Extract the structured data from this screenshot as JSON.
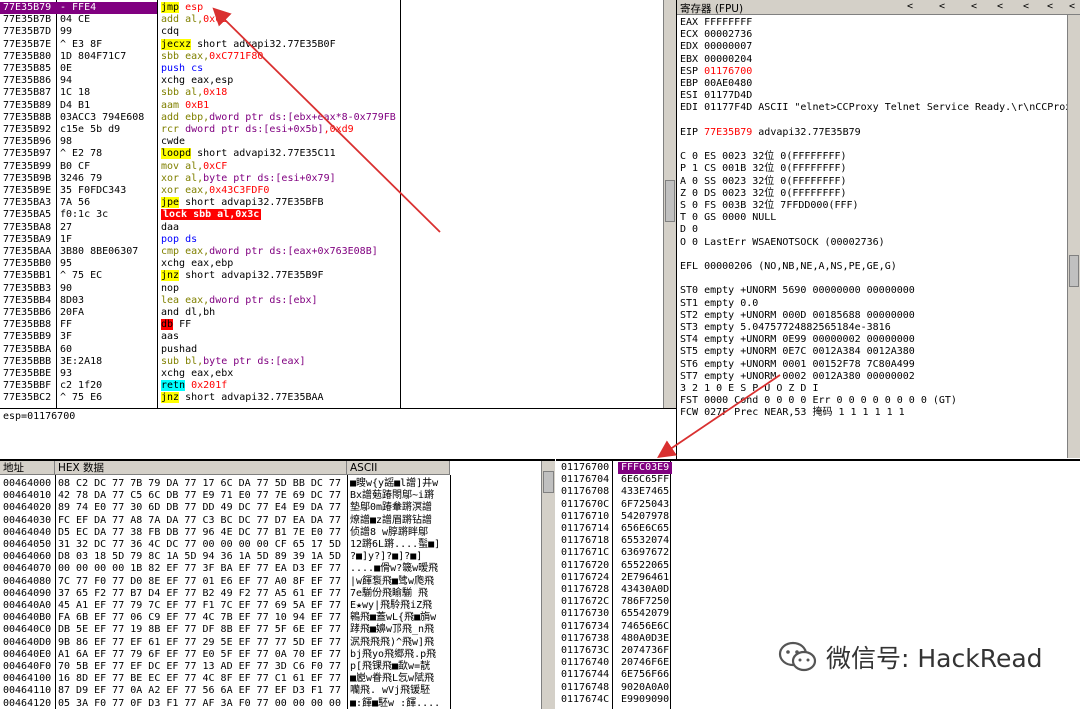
{
  "cpu": {
    "rows": [
      {
        "addr": "77E35B79",
        "hex": "- FFE4",
        "sel": true,
        "parts": [
          [
            "jmp",
            "hl-y"
          ],
          [
            " esp",
            "k-red"
          ]
        ]
      },
      {
        "addr": "77E35B7B",
        "hex": "  04 CE",
        "parts": [
          [
            "add al,",
            "k-olive"
          ],
          [
            "0xCE",
            "k-red"
          ]
        ]
      },
      {
        "addr": "77E35B7D",
        "hex": "  99",
        "parts": [
          [
            "cdq",
            ""
          ]
        ]
      },
      {
        "addr": "77E35B7E",
        "hex": "^ E3 8F",
        "parts": [
          [
            "jecxz",
            "hl-y"
          ],
          [
            " short advapi32.77E35B0F",
            ""
          ]
        ]
      },
      {
        "addr": "77E35B80",
        "hex": "  1D 804F71C7",
        "parts": [
          [
            "sbb eax,",
            "k-olive"
          ],
          [
            "0xC771F80",
            "k-red"
          ]
        ]
      },
      {
        "addr": "77E35B85",
        "hex": "  0E",
        "parts": [
          [
            "push cs",
            "k-blue"
          ]
        ]
      },
      {
        "addr": "77E35B86",
        "hex": "  94",
        "parts": [
          [
            "xchg eax,esp",
            ""
          ]
        ]
      },
      {
        "addr": "77E35B87",
        "hex": "  1C 18",
        "parts": [
          [
            "sbb al,",
            "k-olive"
          ],
          [
            "0x18",
            "k-red"
          ]
        ]
      },
      {
        "addr": "77E35B89",
        "hex": "  D4 B1",
        "parts": [
          [
            "aam ",
            "k-olive"
          ],
          [
            "0xB1",
            "k-red"
          ]
        ]
      },
      {
        "addr": "77E35B8B",
        "hex": "  03ACC3 794E608",
        "parts": [
          [
            "add ebp,",
            "k-olive"
          ],
          [
            "dword ptr ds:[ebx+eax*8-0x779FB",
            "k-dpurple"
          ]
        ]
      },
      {
        "addr": "77E35B92",
        "hex": "  c15e 5b d9",
        "parts": [
          [
            "rcr ",
            "k-olive"
          ],
          [
            "dword ptr ds:[esi+0x5b]",
            "k-dpurple"
          ],
          [
            ",0xd9",
            "k-red"
          ]
        ]
      },
      {
        "addr": "77E35B96",
        "hex": "  98",
        "parts": [
          [
            "cwde",
            ""
          ]
        ]
      },
      {
        "addr": "77E35B97",
        "hex": "^ E2 78",
        "parts": [
          [
            "loopd",
            "hl-y"
          ],
          [
            " short advapi32.77E35C11",
            ""
          ]
        ]
      },
      {
        "addr": "77E35B99",
        "hex": "  B0 CF",
        "parts": [
          [
            "mov al,",
            "k-olive"
          ],
          [
            "0xCF",
            "k-red"
          ]
        ]
      },
      {
        "addr": "77E35B9B",
        "hex": "  3246 79",
        "parts": [
          [
            "xor al,",
            "k-olive"
          ],
          [
            "byte ptr ds:[esi+0x79]",
            "k-dpurple"
          ]
        ]
      },
      {
        "addr": "77E35B9E",
        "hex": "  35 F0FDC343",
        "parts": [
          [
            "xor eax,",
            "k-olive"
          ],
          [
            "0x43C3FDF0",
            "k-red"
          ]
        ]
      },
      {
        "addr": "77E35BA3",
        "hex": "  7A 56",
        "parts": [
          [
            "jpe",
            "hl-y"
          ],
          [
            " short advapi32.77E35BFB",
            ""
          ]
        ]
      },
      {
        "addr": "77E35BA5",
        "hex": "  f0:1c 3c",
        "parts": [
          [
            "lock sbb al,0x3c",
            "lockline"
          ]
        ]
      },
      {
        "addr": "77E35BA8",
        "hex": "  27",
        "parts": [
          [
            "daa",
            ""
          ]
        ]
      },
      {
        "addr": "77E35BA9",
        "hex": "  1F",
        "parts": [
          [
            "pop ds",
            "k-blue"
          ]
        ]
      },
      {
        "addr": "77E35BAA",
        "hex": "  3B80 8BE06307",
        "parts": [
          [
            "cmp eax,",
            "k-olive"
          ],
          [
            "dword ptr ds:[eax+0x763E08B]",
            "k-dpurple"
          ]
        ]
      },
      {
        "addr": "77E35BB0",
        "hex": "  95",
        "parts": [
          [
            "xchg eax,ebp",
            ""
          ]
        ]
      },
      {
        "addr": "77E35BB1",
        "hex": "^ 75 EC",
        "parts": [
          [
            "jnz",
            "hl-y"
          ],
          [
            " short advapi32.77E35B9F",
            ""
          ]
        ]
      },
      {
        "addr": "77E35BB3",
        "hex": "  90",
        "parts": [
          [
            "nop",
            ""
          ]
        ]
      },
      {
        "addr": "77E35BB4",
        "hex": "  8D03",
        "parts": [
          [
            "lea eax,",
            "k-olive"
          ],
          [
            "dword ptr ds:[ebx]",
            "k-dpurple"
          ]
        ]
      },
      {
        "addr": "77E35BB6",
        "hex": "  20FA",
        "parts": [
          [
            "and dl,bh",
            ""
          ]
        ]
      },
      {
        "addr": "77E35BB8",
        "hex": "  FF",
        "parts": [
          [
            "db",
            "hl-r"
          ],
          [
            " FF",
            ""
          ]
        ]
      },
      {
        "addr": "77E35BB9",
        "hex": "  3F",
        "parts": [
          [
            "aas",
            ""
          ]
        ]
      },
      {
        "addr": "77E35BBA",
        "hex": "  60",
        "parts": [
          [
            "pushad",
            ""
          ]
        ]
      },
      {
        "addr": "77E35BBB",
        "hex": "  3E:2A18",
        "parts": [
          [
            "sub bl,",
            "k-olive"
          ],
          [
            "byte ptr ds:[eax]",
            "k-dpurple"
          ]
        ]
      },
      {
        "addr": "77E35BBE",
        "hex": "  93",
        "parts": [
          [
            "xchg eax,ebx",
            ""
          ]
        ]
      },
      {
        "addr": "77E35BBF",
        "hex": "  c2 1f20",
        "parts": [
          [
            "retn",
            "hl-c"
          ],
          [
            " 0x201f",
            "k-red"
          ]
        ]
      },
      {
        "addr": "77E35BC2",
        "hex": "^ 75 E6",
        "parts": [
          [
            "jnz",
            "hl-y"
          ],
          [
            " short advapi32.77E35BAA",
            ""
          ]
        ]
      }
    ]
  },
  "info_line": "esp=01176700",
  "registers": {
    "title": "寄存器 (FPU)",
    "nav": [
      "<",
      "<",
      "<",
      "<",
      "<",
      "<",
      "<"
    ],
    "lines": [
      {
        "t": "EAX FFFFFFFF"
      },
      {
        "t": "ECX 00002736"
      },
      {
        "t": "EDX 00000007"
      },
      {
        "t": "EBX 00000204"
      },
      {
        "t": "ESP ",
        "r": "01176700"
      },
      {
        "t": "EBP 00AE0480"
      },
      {
        "t": "ESI 01177D4D"
      },
      {
        "t": "EDI 01177F4D ASCII \"elnet>CCProxy Telnet Service Ready.\\r\\nCCProxy"
      },
      {
        "t": ""
      },
      {
        "t": "EIP ",
        "r": "77E35B79",
        "t2": " advapi32.77E35B79"
      },
      {
        "t": ""
      },
      {
        "t": "C 0  ES 0023 32位 0(FFFFFFFF)"
      },
      {
        "t": "P 1  CS 001B 32位 0(FFFFFFFF)"
      },
      {
        "t": "A 0  SS 0023 32位 0(FFFFFFFF)"
      },
      {
        "t": "Z 0  DS 0023 32位 0(FFFFFFFF)"
      },
      {
        "t": "S 0  FS 003B 32位 7FFDD000(FFF)"
      },
      {
        "t": "T 0  GS 0000 NULL"
      },
      {
        "t": "D 0"
      },
      {
        "t": "O 0  LastErr WSAENOTSOCK (00002736)"
      },
      {
        "t": ""
      },
      {
        "t": "EFL 00000206 (NO,NB,NE,A,NS,PE,GE,G)"
      },
      {
        "t": ""
      },
      {
        "t": "ST0 empty +UNORM 5690 00000000 00000000"
      },
      {
        "t": "ST1 empty 0.0"
      },
      {
        "t": "ST2 empty +UNORM 000D 00185688 00000000"
      },
      {
        "t": "ST3 empty 5.04757724882565184e-3816"
      },
      {
        "t": "ST4 empty +UNORM 0E99 00000002 00000000"
      },
      {
        "t": "ST5 empty +UNORM 0E7C 0012A384 0012A380"
      },
      {
        "t": "ST6 empty +UNORM 0001 00152F78 7C80A499"
      },
      {
        "t": "ST7 empty +UNORM 0002 0012A380 00000002"
      },
      {
        "t": "               3 2 1 0      E S P U O Z D I"
      },
      {
        "t": "FST 0000  Cond 0 0 0 0  Err 0 0 0 0 0 0 0 0  (GT)"
      },
      {
        "t": "FCW 027F  Prec NEAR,53  掩码    1 1 1 1 1 1"
      }
    ]
  },
  "dump": {
    "h_addr": "地址",
    "h_hex": "HEX 数据",
    "h_ascii": "ASCII",
    "rows": [
      {
        "a": "00464000",
        "h": "08 C2 DC 77 7B 79 DA 77 17 6C DA 77 5D BB DC 77",
        "s": "■瞍w{y謡■l譄]井w"
      },
      {
        "a": "00464010",
        "h": "42 78 DA 77 C5 6C DB 77 E9 71 E0 77 7E 69 DC 77",
        "s": "Bx譄葂踳閝鄔~i蹡"
      },
      {
        "a": "00464020",
        "h": "89 74 E0 77 30 6D DB 77 DD 49 DC 77 E4 E9 DA 77",
        "s": "墊鄔0m踳軬蹡溟譄"
      },
      {
        "a": "00464030",
        "h": "FC EF DA 77 A8 7A DA 77 C3 BC DC 77 D7 EA DA 77",
        "s": "  燎譄■z譄眉蹡钻譄"
      },
      {
        "a": "00464040",
        "h": "D5 EC DA 77 38 FB DB 77 96 4E DC 77 B1 7E E0 77",
        "s": "侦譄8  w朜蹡眫鄔"
      },
      {
        "a": "00464050",
        "h": "31 32 DC 77 36 4C DC 77 00 00 00 00 CF 65 17 5D",
        "s": "12蹡6L蹡....蟚■]"
      },
      {
        "a": "00464060",
        "h": "D8 03 18 5D 79 8C 1A 5D 94 36 1A 5D 89 39 1A 5D",
        "s": "?■]y?]?■]?■]"
      },
      {
        "a": "00464070",
        "h": "00 00 00 00 1B 82 EF 77 3F BA EF 77 EA D3 EF 77",
        "s": "....■傦w?簚w暧飛"
      },
      {
        "a": "00464080",
        "h": "7C 77 F0 77 D0 8E EF 77 01 E6 EF 77 A0 8F EF 77",
        "s": "|w餫袌飛■骘w爮飛"
      },
      {
        "a": "00464090",
        "h": "37 65 F2 77 B7 D4 EF 77 B2 49 F2 77 A5 61 EF 77",
        "s": "7e騚份飛睮騚  飛"
      },
      {
        "a": "004640A0",
        "h": "45 A1 EF 77 79 7C EF 77 F1 7C EF 77 69 5A EF 77",
        "s": "E★wy|飛駖飛iZ飛"
      },
      {
        "a": "004640B0",
        "h": "FA 6B EF 77 06 C9 EF 77 4C 7B EF 77 10 94 EF 77",
        "s": "鷎飛■蓋wL{飛■旓w"
      },
      {
        "a": "004640C0",
        "h": "DB 5E EF 77 19 8B EF 77 DF 8B EF 77 5F 6E EF 77",
        "s": "踍飛■嬶w邒飛_n飛"
      },
      {
        "a": "004640D0",
        "h": "9B 86 EF 77 EF 61 EF 77 29 5E EF 77 77 5D EF 77",
        "s": "泦飛飛飛)^飛w]飛"
      },
      {
        "a": "004640E0",
        "h": "A1 6A EF 77 79 6F EF 77 E0 5F EF 77 0A 70 EF 77",
        "s": "bj飛yo飛郷飛.p飛"
      },
      {
        "a": "004640F0",
        "h": "70 5B EF 77 EF DC EF 77 13 AD EF 77 3D C6 F0 77",
        "s": "p[飛锞飛■歃w=靗"
      },
      {
        "a": "00464100",
        "h": "16 8D EF 77 BE EC EF 77 4C 8F EF 77 C1 61 EF 77",
        "s": "■嶏w眷飛L忥w陚飛"
      },
      {
        "a": "00464110",
        "h": "87 D9 EF 77 0A A2 EF 77 56 6A EF 77 EF D3 F1 77",
        "s": "囒飛.  wVj飛锾駓"
      },
      {
        "a": "00464120",
        "h": "05 3A F0 77 0F D3 F1 77 AF 3A F0 77 00 00 00 00",
        "s": "■:餫■駓w :餫...."
      }
    ]
  },
  "stack": {
    "rows": [
      {
        "a": "01176700",
        "v": "FFFC03E9",
        "sel": true
      },
      {
        "a": "01176704",
        "v": "6E6C65FF"
      },
      {
        "a": "01176708",
        "v": "433E7465"
      },
      {
        "a": "0117670C",
        "v": "6F725043"
      },
      {
        "a": "01176710",
        "v": "54207978"
      },
      {
        "a": "01176714",
        "v": "656E6C65"
      },
      {
        "a": "01176718",
        "v": "65532074"
      },
      {
        "a": "0117671C",
        "v": "63697672"
      },
      {
        "a": "01176720",
        "v": "65522065"
      },
      {
        "a": "01176724",
        "v": "2E796461"
      },
      {
        "a": "01176728",
        "v": "43430A0D"
      },
      {
        "a": "0117672C",
        "v": "786F7250"
      },
      {
        "a": "01176730",
        "v": "65542079"
      },
      {
        "a": "01176734",
        "v": "74656E6C"
      },
      {
        "a": "01176738",
        "v": "480A0D3E"
      },
      {
        "a": "0117673C",
        "v": "2074736F"
      },
      {
        "a": "01176740",
        "v": "20746F6E"
      },
      {
        "a": "01176744",
        "v": "6E756F66"
      },
      {
        "a": "01176748",
        "v": "9020A0A0"
      },
      {
        "a": "0117674C",
        "v": "E9909090"
      }
    ]
  },
  "watermark": {
    "text": "微信号: HackRead"
  },
  "colors": {
    "selection": "#800080",
    "jump_highlight": "#ffff00",
    "lock_line": "#ff0000",
    "arrow": "#d93030"
  }
}
